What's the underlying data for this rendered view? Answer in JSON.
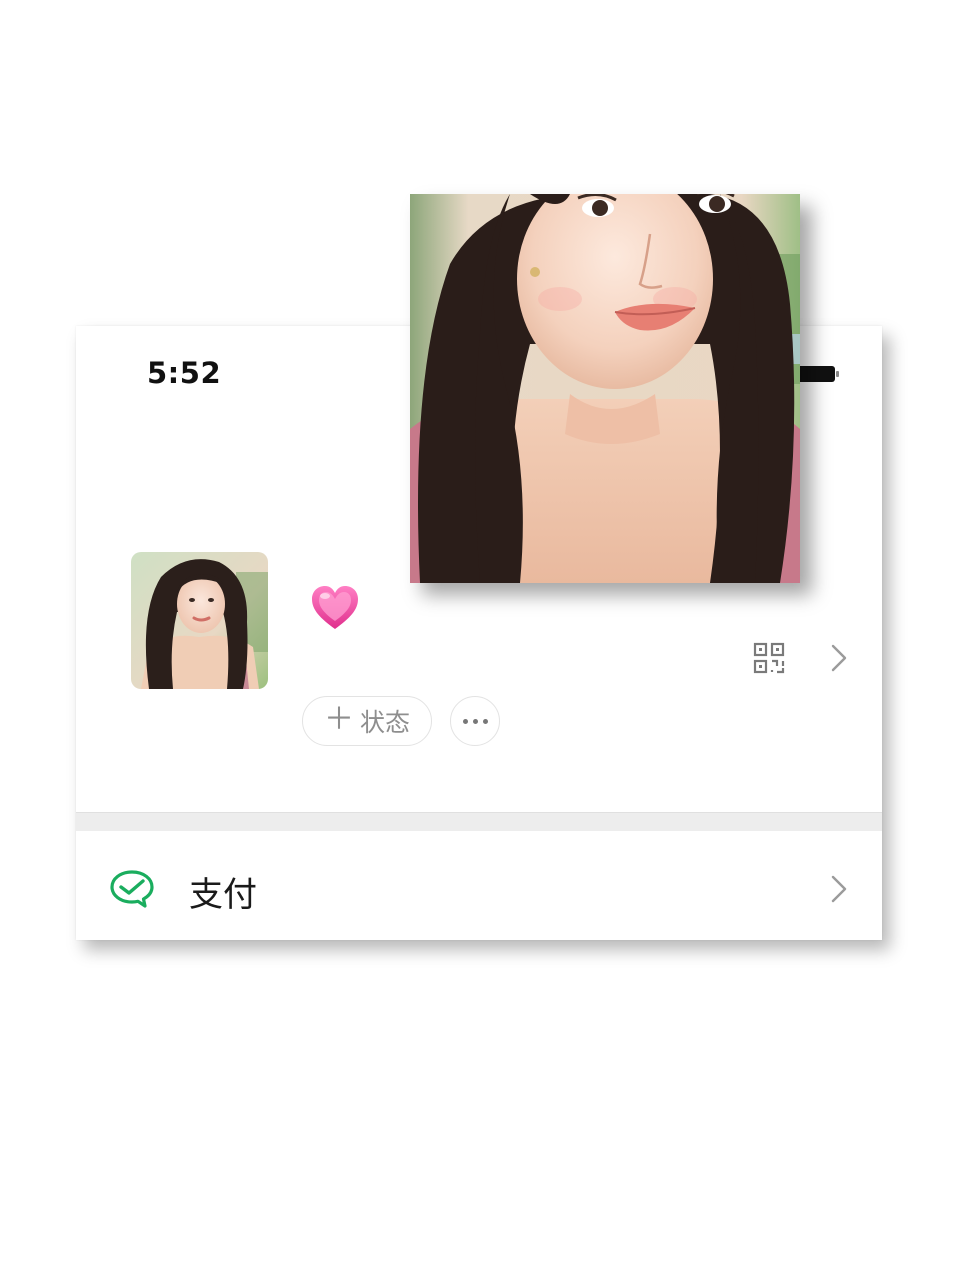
{
  "status_bar": {
    "time": "5:52",
    "battery_icon": "battery-icon"
  },
  "profile": {
    "avatar_icon": "avatar-photo",
    "nickname_emoji": "heart-emoji",
    "qr_icon": "qr-code-icon",
    "chevron_icon": "chevron-right-icon",
    "status_button": {
      "plus": "＋",
      "label": "状态"
    },
    "more_icon": "more-dots-icon"
  },
  "menu": {
    "pay": {
      "icon": "wechat-pay-icon",
      "label": "支付",
      "icon_color": "#1aad5e"
    }
  },
  "overlay_photo": "portrait-photo"
}
